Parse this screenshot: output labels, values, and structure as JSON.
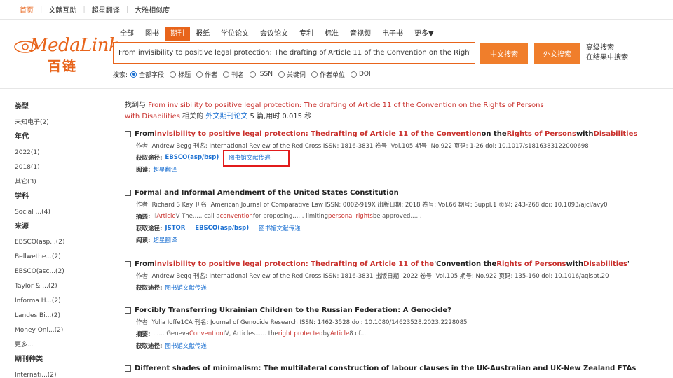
{
  "topnav": {
    "items": [
      "首页",
      "文献互助",
      "超星翻译",
      "大雅相似度"
    ]
  },
  "logo": {
    "en": "MedaLink",
    "cn": "百链"
  },
  "tabs": [
    "全部",
    "图书",
    "期刊",
    "报纸",
    "学位论文",
    "会议论文",
    "专利",
    "标准",
    "音视频",
    "电子书",
    "更多▼"
  ],
  "active_tab": "期刊",
  "search": {
    "value": "From invisibility to positive legal protection: The drafting of Article 11 of the Convention on the Rights of Pers"
  },
  "buttons": {
    "cn": "中文搜索",
    "en": "外文搜索"
  },
  "advanced": {
    "line1": "高级搜索",
    "line2": "在结果中搜索"
  },
  "search_opts": {
    "label": "搜索:",
    "items": [
      "全部字段",
      "标题",
      "作者",
      "刊名",
      "ISSN",
      "关键词",
      "作者单位",
      "DOI"
    ]
  },
  "sidebar": [
    {
      "h": "类型"
    },
    {
      "i": "未知电子(2)"
    },
    {
      "h": "年代"
    },
    {
      "i": "2022(1)"
    },
    {
      "i": "2018(1)"
    },
    {
      "i": "其它(3)"
    },
    {
      "h": "学科"
    },
    {
      "i": "Social ...(4)"
    },
    {
      "h": "来源"
    },
    {
      "i": "EBSCO(asp...(2)"
    },
    {
      "i": "Bellwethe...(2)"
    },
    {
      "i": "EBSCO(asc...(2)"
    },
    {
      "i": "Taylor & ...(2)"
    },
    {
      "i": "Informa H...(2)"
    },
    {
      "i": "Landes Bi...(2)"
    },
    {
      "i": "Money Onl...(2)"
    },
    {
      "i": "更多..."
    },
    {
      "h": "期刊种类"
    },
    {
      "i": "Internati...(2)"
    }
  ],
  "summary": {
    "prefix": "找到与 ",
    "query": "From invisibility to positive legal protection: The drafting of Article 11 of the Convention on the Rights of Persons with Disabilities",
    "mid": " 相关的 ",
    "type": "外文期刊论文",
    "suffix": " 5 篇,用时 0.015 秒"
  },
  "records": [
    {
      "title": [
        {
          "t": "From ",
          "h": false
        },
        {
          "t": "invisibility to positive legal protection: The ",
          "h": true
        },
        {
          "t": "drafting of Article 11 of the Convention",
          "h": true
        },
        {
          "t": " on the ",
          "h": false
        },
        {
          "t": "Rights of Persons",
          "h": true
        },
        {
          "t": " with ",
          "h": false
        },
        {
          "t": "Disabilities",
          "h": true
        }
      ],
      "meta": "作者: Andrew Begg    刊名: International Review of the Red Cross    ISSN: 1816-3831    卷号: Vol.105    期号: No.922    页码: 1-26    doi: 10.1017/s1816383122000698",
      "abs": [],
      "get_label": "获取途径:",
      "get": [
        {
          "t": "EBSCO(asp/bsp)",
          "b": true
        },
        {
          "t": "图书馆文献传递",
          "b": false
        }
      ],
      "read_label": "阅读:",
      "read": "超星翻译"
    },
    {
      "title": [
        {
          "t": "Formal and Informal Amendment of the United States Constitution",
          "h": false
        }
      ],
      "meta": "作者: Richard S Kay    刊名: American Journal of Comparative Law    ISSN: 0002-919X    出版日期: 2018    卷号: Vol.66    期号: Suppl.1    页码: 243-268    doi: 10.1093/ajcl/avy0",
      "abs_label": "摘要:",
      "abs": [
        {
          "t": "Il ",
          "h": false
        },
        {
          "t": "Article",
          "h": true
        },
        {
          "t": " V The..... call a ",
          "h": false
        },
        {
          "t": "convention",
          "h": true
        },
        {
          "t": " for proposing...... limiting ",
          "h": false
        },
        {
          "t": "personal rights",
          "h": true
        },
        {
          "t": " be approved......",
          "h": false
        }
      ],
      "get_label": "获取途径:",
      "get": [
        {
          "t": "JSTOR",
          "b": true
        },
        {
          "t": "EBSCO(asp/bsp)",
          "b": true
        },
        {
          "t": "图书馆文献传递",
          "b": false
        }
      ],
      "read_label": "阅读:",
      "read": "超星翻译"
    },
    {
      "title": [
        {
          "t": "From ",
          "h": false
        },
        {
          "t": "invisibility to positive legal protection: The ",
          "h": true
        },
        {
          "t": "drafting of Article 11 of the",
          "h": true
        },
        {
          "t": " 'Convention the ",
          "h": false
        },
        {
          "t": "Rights of Persons",
          "h": true
        },
        {
          "t": " with ",
          "h": false
        },
        {
          "t": "Disabilities",
          "h": true
        },
        {
          "t": "'",
          "h": false
        }
      ],
      "meta": "作者: Andrew Begg    刊名: International Review of the Red Cross    ISSN: 1816-3831    出版日期: 2022    卷号: Vol.105    期号: No.922    页码: 135-160    doi: 10.1016/agispt.20",
      "abs": [],
      "get_label": "获取途径:",
      "get": [
        {
          "t": "图书馆文献传递",
          "b": false
        }
      ],
      "read_label": "",
      "read": ""
    },
    {
      "title": [
        {
          "t": "Forcibly Transferring Ukrainian Children to the Russian Federation: A Genocide?",
          "h": false
        }
      ],
      "meta": "作者: Yulia Ioffe1CA    刊名: Journal of Genocide Research    ISSN: 1462-3528    doi: 10.1080/14623528.2023.2228085",
      "abs_label": "摘要:",
      "abs": [
        {
          "t": "...... Geneva ",
          "h": false
        },
        {
          "t": "Convention",
          "h": true
        },
        {
          "t": " IV, Articles...... the ",
          "h": false
        },
        {
          "t": "right protected",
          "h": true
        },
        {
          "t": " by ",
          "h": false
        },
        {
          "t": "Article",
          "h": true
        },
        {
          "t": " 8 of...",
          "h": false
        }
      ],
      "get_label": "获取途径:",
      "get": [
        {
          "t": "图书馆文献传递",
          "b": false
        }
      ],
      "read_label": "",
      "read": ""
    },
    {
      "title": [
        {
          "t": "Different shades of minimalism: The multilateral construction of labour clauses in the UK-Australian and UK-New Zealand FTAs",
          "h": false
        }
      ],
      "meta": "",
      "abs": [],
      "get_label": "",
      "get": [],
      "read_label": "",
      "read": ""
    }
  ]
}
